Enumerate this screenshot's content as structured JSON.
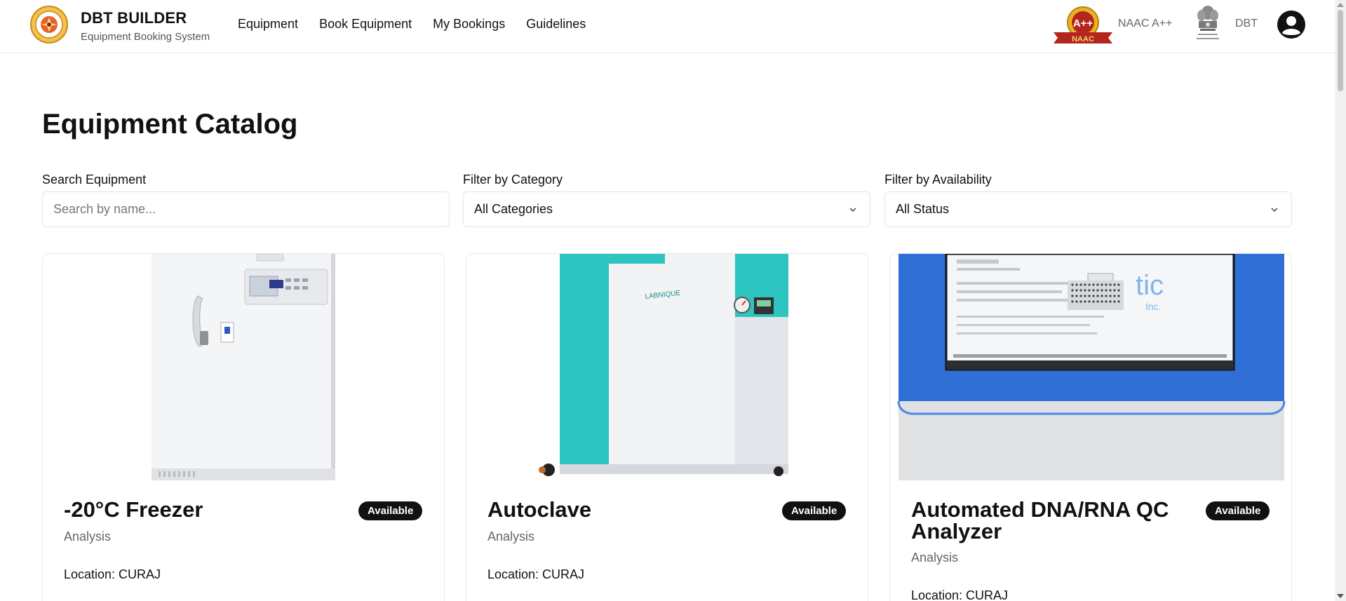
{
  "header": {
    "brand_title": "DBT BUILDER",
    "brand_subtitle": "Equipment Booking System",
    "nav": [
      "Equipment",
      "Book Equipment",
      "My Bookings",
      "Guidelines"
    ],
    "naac_label": "NAAC A++",
    "naac_badge_text": "A++",
    "naac_ribbon_text": "NAAC",
    "dbt_label": "DBT"
  },
  "page": {
    "title": "Equipment Catalog"
  },
  "filters": {
    "search_label": "Search Equipment",
    "search_placeholder": "Search by name...",
    "search_value": "",
    "category_label": "Filter by Category",
    "category_value": "All Categories",
    "availability_label": "Filter by Availability",
    "availability_value": "All Status"
  },
  "equipment": [
    {
      "name": "-20°C Freezer",
      "category": "Analysis",
      "status": "Available",
      "location": "Location: CURAJ"
    },
    {
      "name": "Autoclave",
      "category": "Analysis",
      "status": "Available",
      "location": "Location: CURAJ"
    },
    {
      "name": "Automated DNA/RNA QC Analyzer",
      "category": "Analysis",
      "status": "Available",
      "location": "Location: CURAJ"
    }
  ],
  "images": {
    "autoclave_brand": "LABNIQUE",
    "analyzer_brand": "tic",
    "analyzer_brand_sub": "Inc."
  },
  "colors": {
    "badge_bg": "#111111",
    "accent_teal": "#2ec4c0",
    "accent_blue": "#2f6fd6",
    "naac_gold": "#e8b321",
    "naac_ribbon": "#b3261e"
  }
}
